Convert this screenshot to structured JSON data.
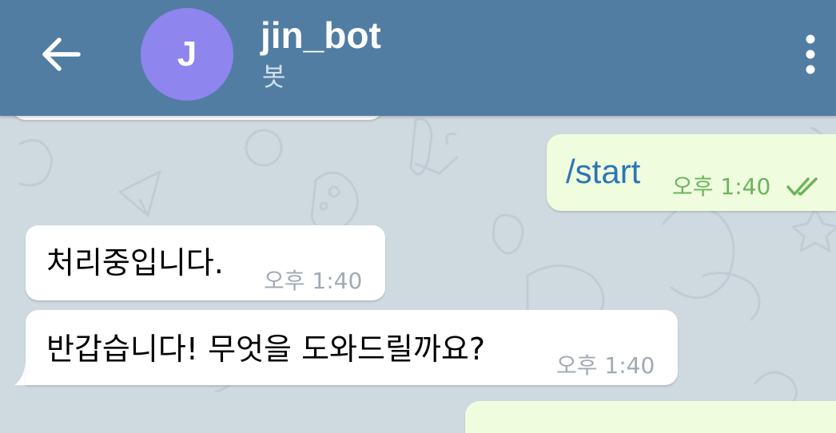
{
  "header": {
    "back_icon": "arrow-left-icon",
    "avatar_letter": "J",
    "avatar_color": "#8e85ee",
    "title": "jin_bot",
    "subtitle": "봇",
    "menu_icon": "more-vertical-icon",
    "bar_color": "#517da2"
  },
  "messages": [
    {
      "direction": "outgoing",
      "text": "/start",
      "time": "오후 1:40",
      "status_icon": "double-check-icon"
    },
    {
      "direction": "incoming",
      "text": "처리중입니다.",
      "time": "오후 1:40"
    },
    {
      "direction": "incoming",
      "text": "반갑습니다! 무엇을 도와드릴까요?",
      "time": "오후 1:40"
    }
  ],
  "colors": {
    "chat_background": "#cfd9e0",
    "incoming_bubble": "#ffffff",
    "outgoing_bubble": "#effdde",
    "command_link": "#2d75b6",
    "outgoing_time": "#6cb35b",
    "incoming_time": "#a1aab3"
  }
}
